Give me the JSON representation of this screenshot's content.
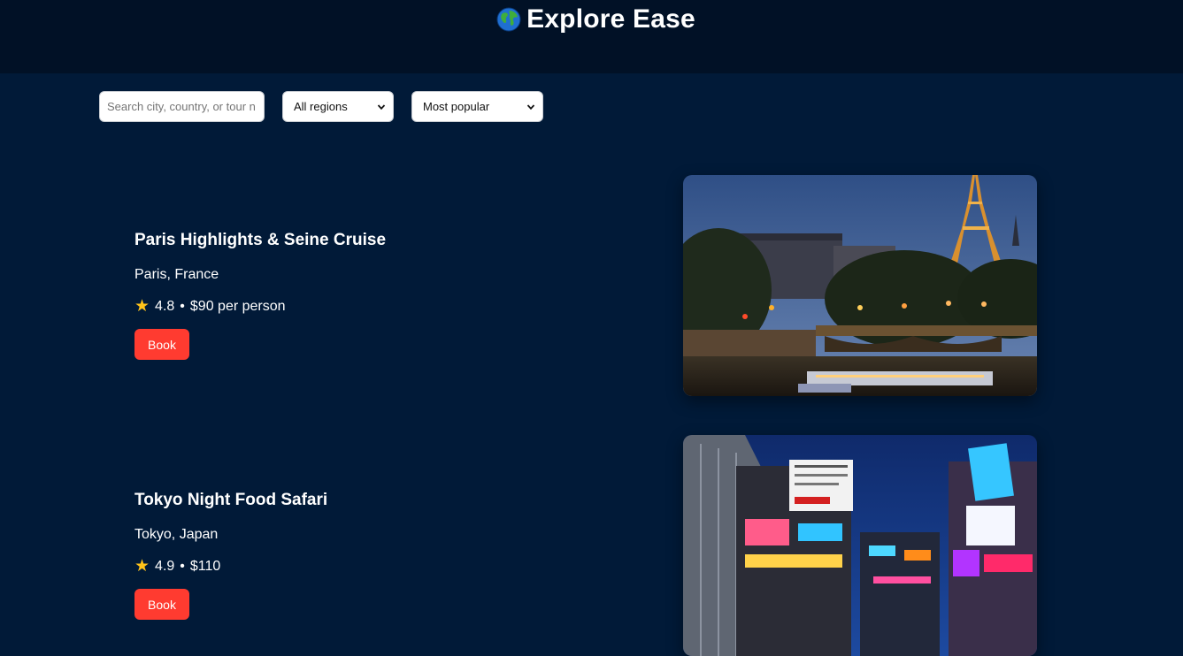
{
  "header": {
    "title": "Explore Ease",
    "logo_icon": "globe-icon"
  },
  "filters": {
    "search_placeholder": "Search city, country, or tour n",
    "region_value": "All regions",
    "sort_value": "Most popular"
  },
  "tours": [
    {
      "title": "Paris Highlights & Seine Cruise",
      "location": "Paris, France",
      "rating": "4.8",
      "price_text": "$90 per person",
      "book_label": "Book"
    },
    {
      "title": "Tokyo Night Food Safari",
      "location": "Tokyo, Japan",
      "rating": "4.9",
      "price_text": "$110",
      "book_label": "Book"
    }
  ],
  "colors": {
    "page_bg": "#011a38",
    "header_bg": "#011126",
    "book_button": "#ff3b30",
    "star": "#ffc31a"
  }
}
